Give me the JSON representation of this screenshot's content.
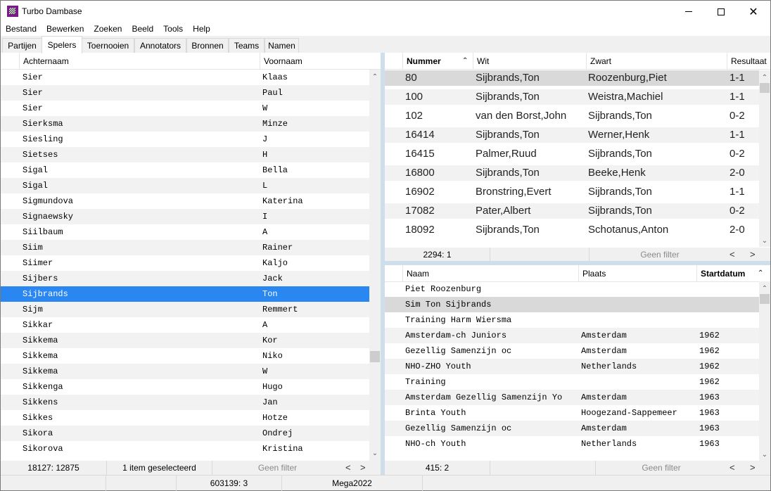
{
  "window": {
    "title": "Turbo Dambase",
    "controls": {
      "minimize": "minimize",
      "maximize": "maximize",
      "close": "close"
    }
  },
  "menu": [
    "Bestand",
    "Bewerken",
    "Zoeken",
    "Beeld",
    "Tools",
    "Help"
  ],
  "tabs": [
    {
      "label": "Partijen",
      "active": false
    },
    {
      "label": "Spelers",
      "active": true
    },
    {
      "label": "Toernooien",
      "active": false
    },
    {
      "label": "Annotators",
      "active": false
    },
    {
      "label": "Bronnen",
      "active": false
    },
    {
      "label": "Teams",
      "active": false
    },
    {
      "label": "Namen",
      "active": false
    }
  ],
  "players": {
    "columns": [
      "Achternaam",
      "Voornaam"
    ],
    "rows": [
      [
        "Sier",
        "Klaas"
      ],
      [
        "Sier",
        "Paul"
      ],
      [
        "Sier",
        "W"
      ],
      [
        "Sierksma",
        "Minze"
      ],
      [
        "Siesling",
        "J"
      ],
      [
        "Sietses",
        "H"
      ],
      [
        "Sigal",
        "Bella"
      ],
      [
        "Sigal",
        "L"
      ],
      [
        "Sigmundova",
        "Katerina"
      ],
      [
        "Signaewsky",
        "I"
      ],
      [
        "Siilbaum",
        "A"
      ],
      [
        "Siim",
        "Rainer"
      ],
      [
        "Siimer",
        "Kaljo"
      ],
      [
        "Sijbers",
        "Jack"
      ],
      [
        "Sijbrands",
        "Ton"
      ],
      [
        "Sijm",
        "Remmert"
      ],
      [
        "Sikkar",
        "A"
      ],
      [
        "Sikkema",
        "Kor"
      ],
      [
        "Sikkema",
        "Niko"
      ],
      [
        "Sikkema",
        "W"
      ],
      [
        "Sikkenga",
        "Hugo"
      ],
      [
        "Sikkens",
        "Jan"
      ],
      [
        "Sikkes",
        "Hotze"
      ],
      [
        "Sikora",
        "Ondrej"
      ],
      [
        "Sikorova",
        "Kristina"
      ]
    ],
    "selected_index": 14,
    "status": {
      "count": "18127: 12875",
      "selection": "1 item geselecteerd",
      "filter": "Geen filter",
      "prev": "<",
      "next": ">"
    }
  },
  "games": {
    "columns": [
      "Nummer",
      "Wit",
      "Zwart",
      "Resultaat"
    ],
    "sorted_column": "Nummer",
    "rows": [
      [
        "80",
        "Sijbrands,Ton",
        "Roozenburg,Piet",
        "1-1"
      ],
      [
        "100",
        "Sijbrands,Ton",
        "Weistra,Machiel",
        "1-1"
      ],
      [
        "102",
        "van den Borst,John",
        "Sijbrands,Ton",
        "0-2"
      ],
      [
        "16414",
        "Sijbrands,Ton",
        "Werner,Henk",
        "1-1"
      ],
      [
        "16415",
        "Palmer,Ruud",
        "Sijbrands,Ton",
        "0-2"
      ],
      [
        "16800",
        "Sijbrands,Ton",
        "Beeke,Henk",
        "2-0"
      ],
      [
        "16902",
        "Bronstring,Evert",
        "Sijbrands,Ton",
        "1-1"
      ],
      [
        "17082",
        "Pater,Albert",
        "Sijbrands,Ton",
        "0-2"
      ],
      [
        "18092",
        "Sijbrands,Ton",
        "Schotanus,Anton",
        "2-0"
      ]
    ],
    "current_index": 0,
    "status": {
      "count": "2294: 1",
      "filter": "Geen filter",
      "prev": "<",
      "next": ">"
    }
  },
  "tournaments": {
    "columns": [
      "Naam",
      "Plaats",
      "Startdatum"
    ],
    "sorted_column": "Startdatum",
    "rows": [
      [
        "Piet Roozenburg",
        "",
        ""
      ],
      [
        "Sim Ton Sijbrands",
        "",
        ""
      ],
      [
        "Training Harm Wiersma",
        "",
        ""
      ],
      [
        "Amsterdam-ch Juniors",
        "Amsterdam",
        "1962"
      ],
      [
        "Gezellig Samenzijn oc",
        "Amsterdam",
        "1962"
      ],
      [
        "NHO-ZHO Youth",
        "Netherlands",
        "1962"
      ],
      [
        "Training",
        "",
        "1962"
      ],
      [
        "Amsterdam Gezellig Samenzijn Yo",
        "Amsterdam",
        "1963"
      ],
      [
        "Brinta Youth",
        "Hoogezand-Sappemeer",
        "1963"
      ],
      [
        "Gezellig Samenzijn oc",
        "Amsterdam",
        "1963"
      ],
      [
        "NHO-ch Youth",
        "Netherlands",
        "1963"
      ]
    ],
    "current_index": 1,
    "status": {
      "count": "415: 2",
      "filter": "Geen filter",
      "prev": "<",
      "next": ">"
    }
  },
  "app_status": {
    "cell1": "",
    "cell2": "",
    "records": "603139: 3",
    "database": "Mega2022"
  },
  "colors": {
    "selection": "#2a86f0",
    "current_row": "#d9d9d9",
    "alt_row": "#f2f2f2",
    "splitter": "#cfdeeb"
  }
}
